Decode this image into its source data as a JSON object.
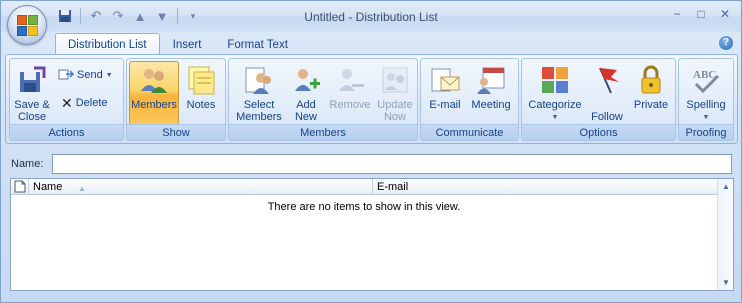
{
  "window": {
    "title": "Untitled - Distribution List"
  },
  "qat": {
    "items": [
      "save-icon",
      "undo-icon",
      "redo-icon",
      "up-arrow-icon",
      "down-arrow-icon",
      "customize-qat-icon"
    ]
  },
  "tabs": [
    {
      "label": "Distribution List",
      "active": true
    },
    {
      "label": "Insert",
      "active": false
    },
    {
      "label": "Format Text",
      "active": false
    }
  ],
  "ribbon": {
    "actions": {
      "label": "Actions",
      "save_close": "Save &\nClose",
      "send": "Send",
      "delete": "Delete"
    },
    "show": {
      "label": "Show",
      "members": "Members",
      "notes": "Notes"
    },
    "members": {
      "label": "Members",
      "select_members": "Select\nMembers",
      "add_new": "Add\nNew",
      "remove": "Remove",
      "update_now": "Update\nNow"
    },
    "communicate": {
      "label": "Communicate",
      "email": "E-mail",
      "meeting": "Meeting"
    },
    "options": {
      "label": "Options",
      "categorize": "Categorize",
      "follow_up": "Follow\nUp",
      "private": "Private"
    },
    "proofing": {
      "label": "Proofing",
      "spelling": "Spelling"
    }
  },
  "form": {
    "name_label": "Name:",
    "name_value": ""
  },
  "list": {
    "columns": [
      "Name",
      "E-mail"
    ],
    "empty_message": "There are no items to show in this view."
  },
  "colors": {
    "accent": "#15428b",
    "selected": "#fbd56a"
  }
}
